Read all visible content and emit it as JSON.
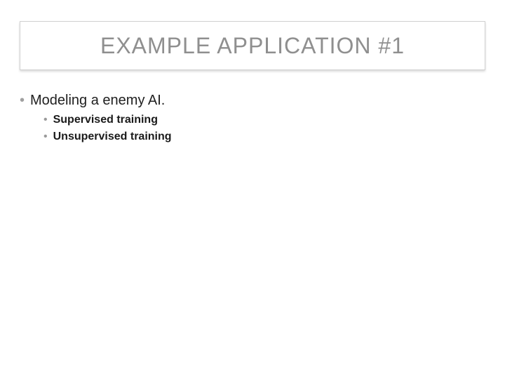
{
  "title": "EXAMPLE APPLICATION #1",
  "bullets": {
    "level1": {
      "item0": "Modeling a enemy AI."
    },
    "level2": {
      "item0": "Supervised training",
      "item1": "Unsupervised training"
    }
  }
}
